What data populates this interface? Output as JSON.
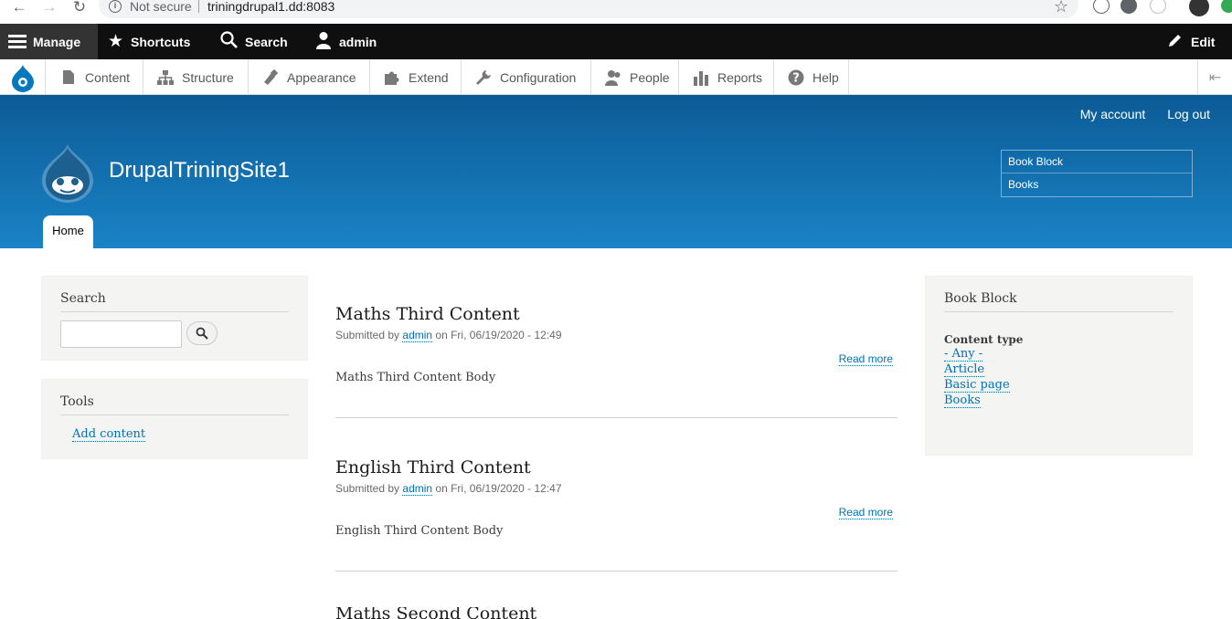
{
  "browser": {
    "security_label": "Not secure",
    "url": "triningdrupal1.dd:8083"
  },
  "toolbar": {
    "manage": "Manage",
    "shortcuts": "Shortcuts",
    "search": "Search",
    "user": "admin",
    "edit": "Edit"
  },
  "tray": {
    "items": [
      {
        "label": "Content",
        "icon": "file-icon"
      },
      {
        "label": "Structure",
        "icon": "sitemap-icon"
      },
      {
        "label": "Appearance",
        "icon": "paint-icon"
      },
      {
        "label": "Extend",
        "icon": "puzzle-icon"
      },
      {
        "label": "Configuration",
        "icon": "wrench-icon"
      },
      {
        "label": "People",
        "icon": "person-icon"
      },
      {
        "label": "Reports",
        "icon": "bar-chart-icon"
      },
      {
        "label": "Help",
        "icon": "question-icon"
      }
    ]
  },
  "header": {
    "my_account": "My account",
    "log_out": "Log out",
    "site_name": "DrupalTriningSite1",
    "block_items": [
      "Book Block",
      "Books"
    ],
    "home_tab": "Home"
  },
  "sidebar_left": {
    "search_title": "Search",
    "tools_title": "Tools",
    "add_content": "Add content"
  },
  "nodes": [
    {
      "title": "Maths Third Content",
      "submitted_prefix": "Submitted by",
      "author": "admin",
      "date": "on Fri, 06/19/2020 - 12:49",
      "read_more": "Read more",
      "body": "Maths Third Content Body"
    },
    {
      "title": "English Third Content",
      "submitted_prefix": "Submitted by",
      "author": "admin",
      "date": "on Fri, 06/19/2020 - 12:47",
      "read_more": "Read more",
      "body": "English Third Content Body"
    },
    {
      "title": "Maths Second Content"
    }
  ],
  "sidebar_right": {
    "title": "Book Block",
    "facet_label": "Content type",
    "facets": [
      "- Any -",
      "Article",
      "Basic page",
      "Books"
    ]
  },
  "colors": {
    "header_top": "#0c5b96",
    "header_bottom": "#1a83c6",
    "link": "#0071b3",
    "toolbar_bg": "#0f0f0f"
  }
}
